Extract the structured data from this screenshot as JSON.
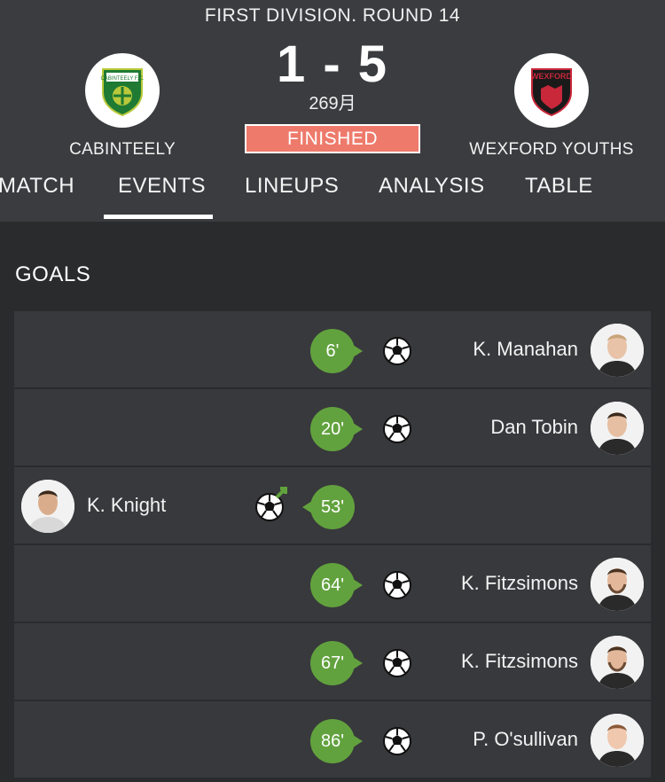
{
  "match": {
    "round_title": "FIRST DIVISION. ROUND 14",
    "score": "1 - 5",
    "date": "269月",
    "status": "FINISHED",
    "home_team": "CABINTEELY",
    "away_team": "WEXFORD YOUTHS",
    "home_logo_text": "CABINTEELY F.C.",
    "away_logo_text": "WEXFORD"
  },
  "tabs": [
    {
      "label": "MATCH"
    },
    {
      "label": "EVENTS",
      "active": true
    },
    {
      "label": "LINEUPS"
    },
    {
      "label": "ANALYSIS"
    },
    {
      "label": "TABLE"
    }
  ],
  "goals": {
    "title": "GOALS",
    "items": [
      {
        "minute": "6'",
        "player": "K. Manahan",
        "side": "away"
      },
      {
        "minute": "20'",
        "player": "Dan Tobin",
        "side": "away"
      },
      {
        "minute": "53'",
        "player": "K. Knight",
        "side": "home"
      },
      {
        "minute": "64'",
        "player": "K. Fitzsimons",
        "side": "away"
      },
      {
        "minute": "67'",
        "player": "K. Fitzsimons",
        "side": "away"
      },
      {
        "minute": "86'",
        "player": "P. O'sullivan",
        "side": "away"
      }
    ]
  },
  "colors": {
    "header_bg": "#3a3c3f",
    "page_bg": "#2a2b2d",
    "row_bg": "#38393c",
    "minute_badge": "#62a23e",
    "status_badge": "#ee7a6b"
  }
}
